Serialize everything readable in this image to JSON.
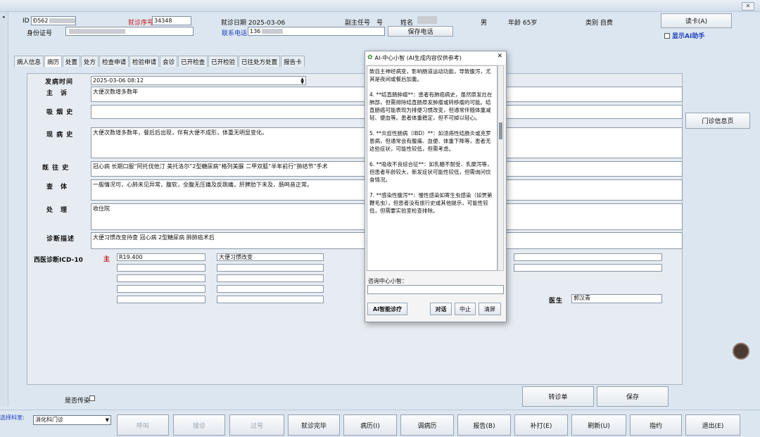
{
  "window": {
    "close_label": "✕"
  },
  "patient": {
    "id_label": "ID",
    "id_value": "Ð562",
    "visit_no_label": "就诊序号",
    "visit_no_value": "34348",
    "visit_date_text": "就诊日期 2025-03-06",
    "title_text": "副主任号　号",
    "name_label": "姓名",
    "gender": "男",
    "age_text": "年龄 65岁",
    "category_text": "类别 自费",
    "idcard_label": "身份证号",
    "phone_label": "联系电话",
    "phone_value": "136",
    "save_phone_label": "保存电话",
    "read_card_label": "读卡(A)",
    "show_ai_label": "显示AI助手"
  },
  "tabs": [
    "病人信息",
    "病历",
    "处置",
    "处方",
    "检查申请",
    "检验申请",
    "会诊",
    "已开检查",
    "已开检验",
    "已往处方处置",
    "报告卡"
  ],
  "form": {
    "onset_time_label": "发病时间",
    "onset_time_value": "2025-03-06 08:12",
    "chief_label": "主　诉",
    "chief_value": "大便次数增多数年",
    "smoking_label": "吸 烟 史",
    "smoking_value": "",
    "present_label": "现 病 史",
    "present_value": "大便次数增多数年，餐后后出现，伴有大便不成形，体重无明显变化。",
    "past_label": "既 往 史",
    "past_value": "冠心病 长期口服“阿托伐他汀 美托洛尔”2型糖尿病“格列美脲 二甲双胍”半年前行“肺结节”手术",
    "exam_label": "查　体",
    "exam_value": "一般情况可，心肺未见异常，腹软，全腹无压痛及反跳痛，肝脾肋下未及，肠鸣音正常。",
    "treat_label": "处　理",
    "treat_value": "收住院",
    "diag_desc_label": "诊断描述",
    "diag_desc_value": "大便习惯改变待查 冠心病 2型糖尿病 肺肺癌术后",
    "icd_label": "西医诊断ICD-10",
    "icd_primary_label": "主",
    "icd_code": "R19.400",
    "icd_name": "大便习惯改变",
    "doctor_label": "医生",
    "doctor_value": "郭汉青",
    "clinic_info_label": "门诊信息页",
    "infectious_label": "是否传染",
    "transfer_label": "转诊单",
    "save_label": "保存"
  },
  "ai_dialog": {
    "title": "AI-中心小智 (AI生成内容仅供参考)",
    "close_label": "✕",
    "paragraphs": [
      "致自主神经病变，影响肠道运动功能，导致腹泻，尤其是夜间或餐后加重。",
      "4. **结直肠肿瘤**：患者有肺癌病史，虽然原发灶在肺部，但需排除结直肠原发肿瘤或转移瘤的可能。结直肠癌可能表现为排便习惯改变，但通常伴随体重减轻、便血等。患者体重稳定，但不可掉以轻心。",
      "5. **炎症性肠病（IBD）**：如溃疡性结肠炎或克罗恩病，但通常会有腹痛、血便、体重下降等，患者无这些症状，可能性较低，但需考虑。",
      "6. **吸收不良综合征**：如乳糖不耐受、乳糜泻等，但患者年龄较大，新发症状可能性较低，但需询问饮食情况。",
      "7. **感染性腹泻**：慢性感染如寄生虫感染（如贾第鞭毛虫），但患者没有旅行史或其他提示，可能性较低，但需要实验室检查排除。"
    ],
    "consult_label": "咨询中心小智：",
    "smart_diag_label": "AI智能诊疗",
    "dialog_label": "对话",
    "stop_label": "中止",
    "clear_label": "清屏"
  },
  "bottom": {
    "dept_label": "选择科室:",
    "dept_value": "消化科门诊",
    "buttons": [
      "呼叫",
      "接诊",
      "过号",
      "就诊完毕",
      "病历(I)",
      "调病历",
      "报告(B)",
      "补打(E)",
      "刷新(U)",
      "指约",
      "退出(E)"
    ]
  }
}
